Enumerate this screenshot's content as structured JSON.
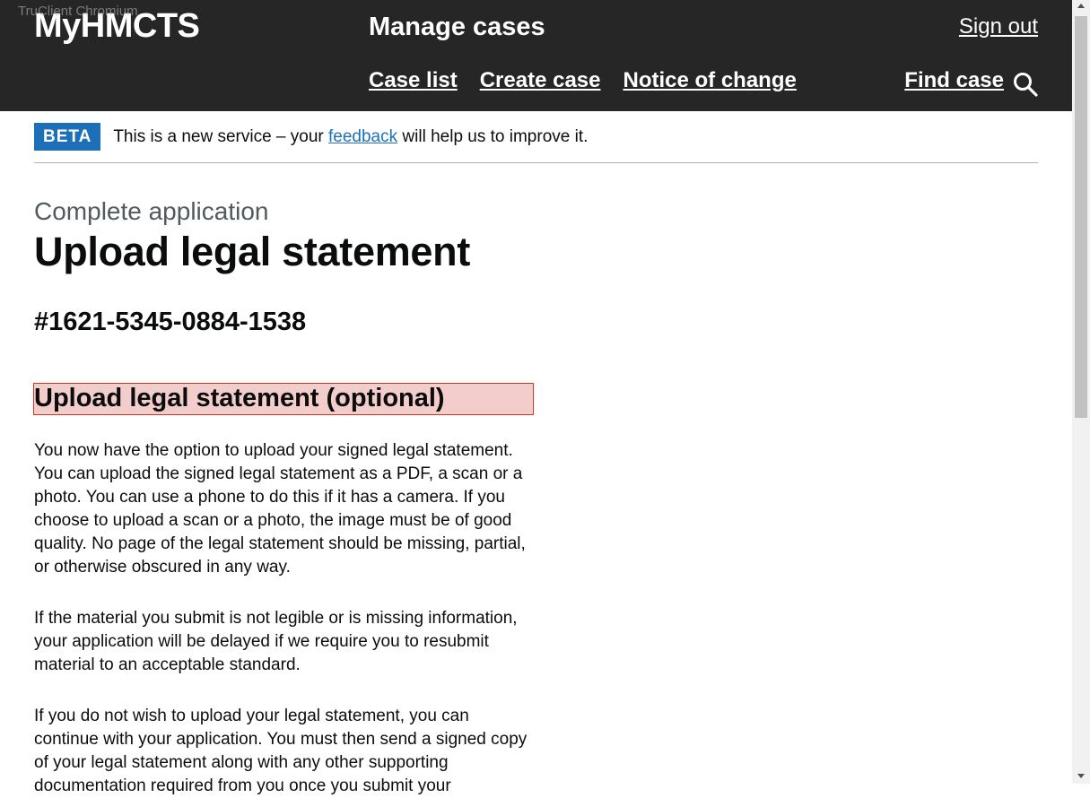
{
  "browser": {
    "title": "TruClient Chromium"
  },
  "header": {
    "logo": "MyHMCTS",
    "service_name": "Manage cases",
    "sign_out": "Sign out",
    "nav": [
      "Case list",
      "Create case",
      "Notice of change"
    ],
    "find_case": "Find case",
    "search_icon": "search-icon"
  },
  "phase_banner": {
    "tag": "BETA",
    "text_before": "This is a new service – your ",
    "link": "feedback",
    "text_after": " will help us to improve it."
  },
  "page": {
    "caption": "Complete application",
    "title": "Upload legal statement",
    "case_id": "#1621-5345-0884-1538",
    "section_heading": "Upload legal statement (optional)",
    "paragraphs": [
      "You now have the option to upload your signed legal statement. You can upload the signed legal statement as a PDF, a scan or a photo. You can use a phone to do this if it has a camera. If you choose to upload a scan or a photo, the image must be of good quality. No page of the legal statement should be missing, partial, or otherwise obscured in any way.",
      "If the material you submit is not legible or is missing information, your application will be delayed if we require you to resubmit material to an acceptable standard.",
      "If you do not wish to upload your legal statement, you can continue with your application. You must then send a signed copy of your legal statement along with any other supporting documentation required from you once you submit your"
    ]
  },
  "colors": {
    "header_bg": "#262626",
    "link": "#1d70b8",
    "beta_tag": "#1d70b8",
    "highlight_bg": "#f3cccc",
    "highlight_border": "#d4351c"
  }
}
